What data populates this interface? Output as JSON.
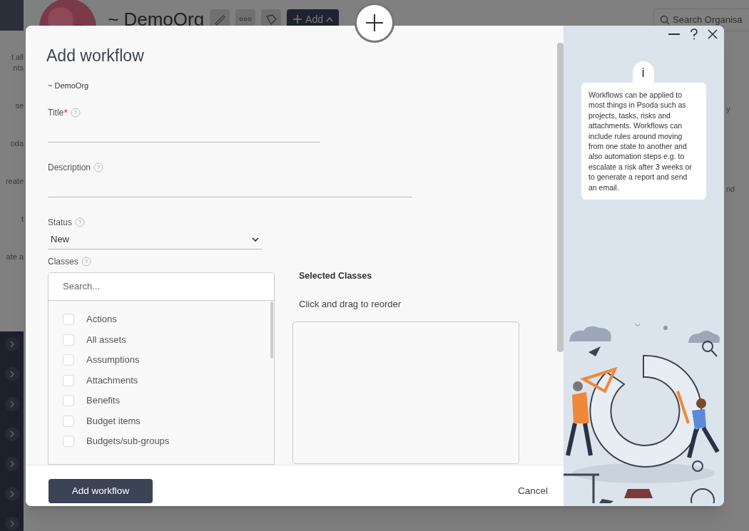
{
  "background": {
    "org_title": "~ DemoOrg",
    "add_button": "Add",
    "search": {
      "placeholder": "Search Organisa"
    },
    "sidebar_fragments": [
      "t all\nnts",
      "se",
      "oda",
      "reate",
      "t",
      "ate a"
    ],
    "right_fragments": [
      "y",
      "nd"
    ]
  },
  "dialog": {
    "title": "Add workflow",
    "org": "~ DemoOrg",
    "required_mark": "*",
    "fields": [
      {
        "kind": "text",
        "label": "Title",
        "required": true
      },
      {
        "kind": "text",
        "label": "Description",
        "required": false
      },
      {
        "kind": "select",
        "label": "Status",
        "required": false,
        "value": "New"
      }
    ],
    "classes": {
      "label": "Classes",
      "search": {
        "placeholder": "Search..."
      },
      "items": [
        {
          "label": "Actions",
          "checked": false
        },
        {
          "label": "All assets",
          "checked": false
        },
        {
          "label": "Assumptions",
          "checked": false
        },
        {
          "label": "Attachments",
          "checked": false
        },
        {
          "label": "Benefits",
          "checked": false
        },
        {
          "label": "Budget items",
          "checked": false
        },
        {
          "label": "Budgets/sub-groups",
          "checked": false
        }
      ],
      "selected_heading": "Selected Classes",
      "selected_hint": "Click and drag to reorder"
    },
    "info": {
      "icon": "i",
      "text": "Workflows can be applied to most things in Psoda such as projects, tasks, risks and attachments. Workflows can include rules around moving from one state to another and also automation steps e.g. to escalate a risk after 3 weeks or to generate a report and send an email."
    },
    "buttons": {
      "primary": "Add workflow",
      "cancel": "Cancel"
    }
  }
}
